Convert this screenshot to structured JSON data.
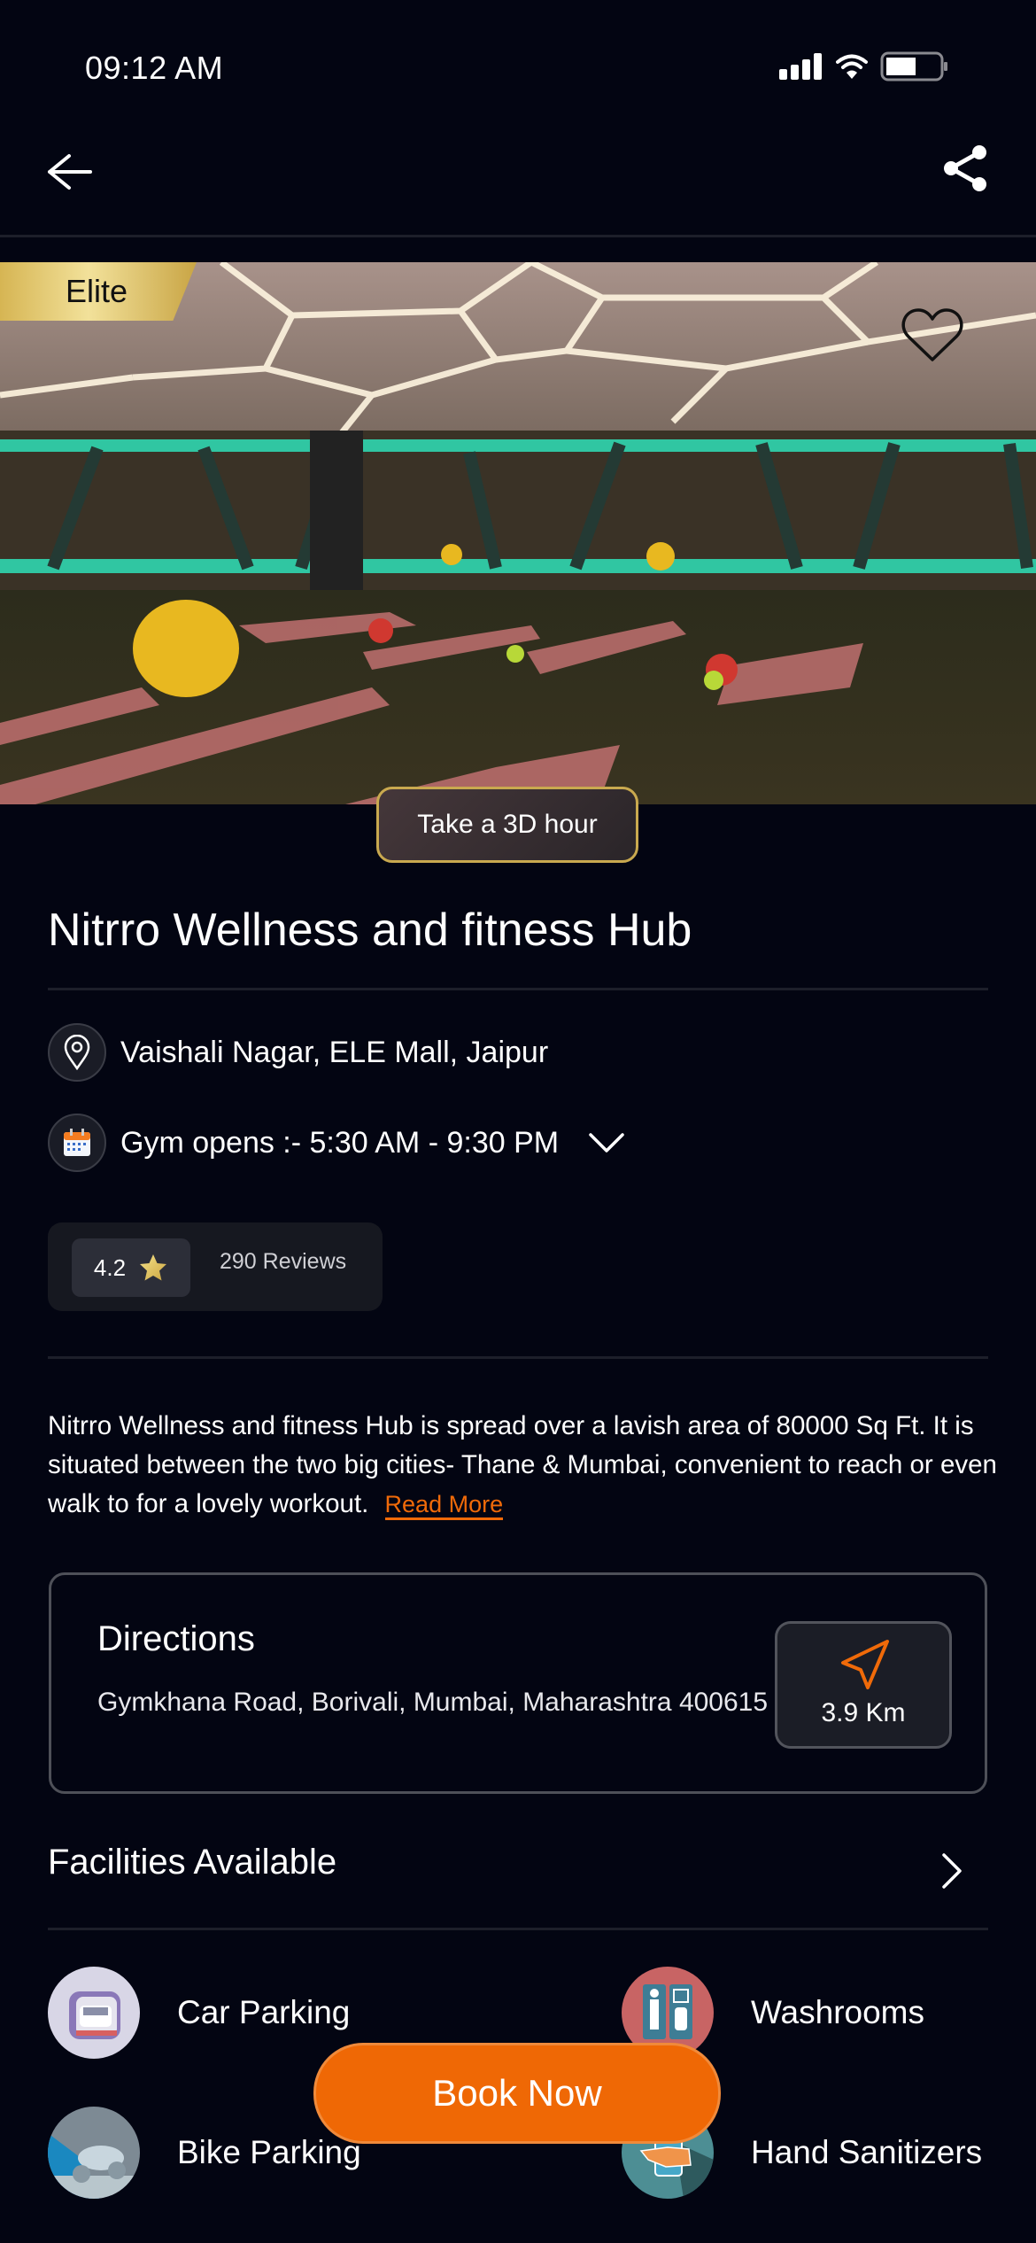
{
  "status_bar": {
    "time": "09:12 AM",
    "icons": [
      "signal-icon",
      "wifi-icon",
      "battery-icon"
    ],
    "battery_level": 0.5
  },
  "nav": {
    "back_icon": "arrow-left-icon",
    "share_icon": "share-icon"
  },
  "hero": {
    "badge": "Elite",
    "favorite_icon": "heart-outline-icon",
    "tour_button": "Take a 3D hour"
  },
  "gym": {
    "name": "Nitrro Wellness and fitness Hub",
    "location": "Vaishali Nagar, ELE Mall, Jaipur",
    "hours": "Gym opens :- 5:30 AM - 9:30 PM",
    "rating": "4.2",
    "reviews": "290 Reviews",
    "description": "Nitrro Wellness and fitness Hub is spread over a lavish area of 80000 Sq Ft. It is situated between the two big cities- Thane & Mumbai, convenient to reach or even walk to for a lovely workout.",
    "read_more": "Read More"
  },
  "directions": {
    "title": "Directions",
    "address": "Gymkhana Road, Borivali, Mumbai, Maharashtra 400615",
    "distance": "3.9 Km"
  },
  "facilities": {
    "title": "Facilities Available",
    "items": [
      {
        "label": "Car Parking",
        "icon": "car-parking-icon"
      },
      {
        "label": "Washrooms",
        "icon": "washroom-icon"
      },
      {
        "label": "Bike Parking",
        "icon": "bike-parking-icon"
      },
      {
        "label": "Hand Sanitizers",
        "icon": "hand-sanitizer-icon"
      }
    ]
  },
  "cta": {
    "book_now": "Book Now"
  },
  "colors": {
    "background": "#030512",
    "accent": "#ef6805",
    "gold": "#c9a94f"
  }
}
